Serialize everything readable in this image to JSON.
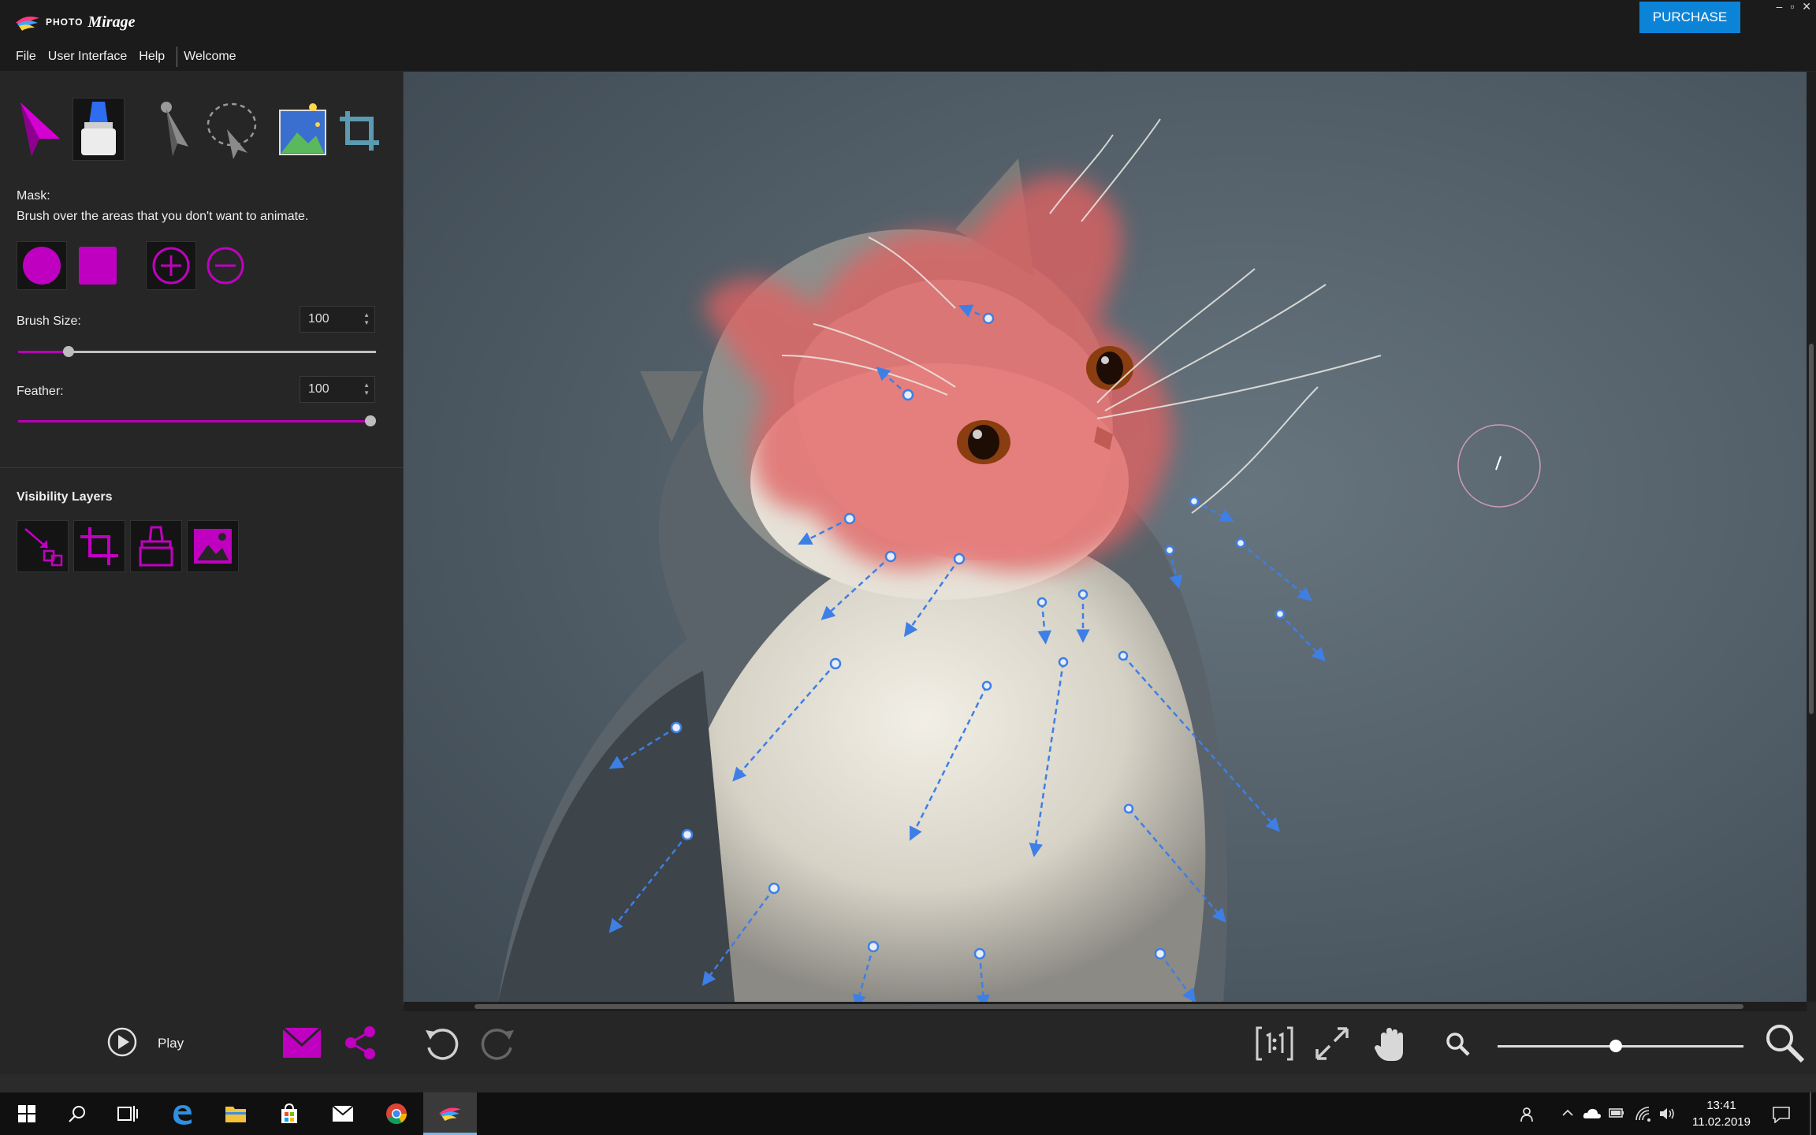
{
  "app": {
    "brand_photo": "PHOTO",
    "brand_mirage": "Mirage",
    "purchase_label": "PURCHASE",
    "window_controls": [
      "–",
      "▫",
      "✕"
    ]
  },
  "menu": {
    "items": [
      "File",
      "User Interface",
      "Help",
      "Welcome"
    ]
  },
  "tools": {
    "items": [
      "animate-tool",
      "mask-tool",
      "anchor-tool",
      "select-tool",
      "background-tool",
      "crop-tool"
    ],
    "active": "mask-tool"
  },
  "mask_panel": {
    "title": "Mask:",
    "hint": "Brush over the areas that you don't want to animate.",
    "brush_shapes": [
      "circle",
      "square"
    ],
    "modes": [
      "add",
      "subtract"
    ],
    "brush_size_label": "Brush Size:",
    "brush_size_value": "100",
    "brush_size_fraction": 0.14,
    "feather_label": "Feather:",
    "feather_value": "100",
    "feather_fraction": 1.0
  },
  "visibility": {
    "title": "Visibility Layers",
    "layers": [
      "motion-layer",
      "crop-layer",
      "mask-layer",
      "image-layer"
    ]
  },
  "bottom": {
    "play_label": "Play",
    "zoom_fraction": 0.48
  },
  "taskbar": {
    "time": "13:41",
    "date": "11.02.2019"
  },
  "colors": {
    "accent": "#b600b6",
    "purchase": "#0b84d8",
    "arrow": "#3e7fe6",
    "mask": "#e06262"
  }
}
